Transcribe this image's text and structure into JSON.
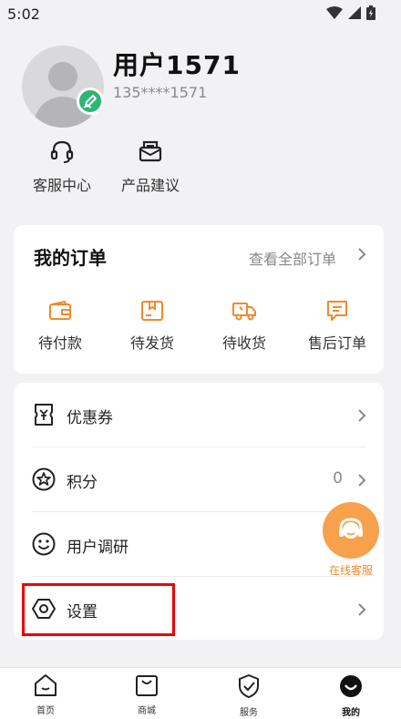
{
  "status_bar": {
    "time": "5:02"
  },
  "profile": {
    "username": "用户1571",
    "phone": "135****1571"
  },
  "quick_actions": [
    {
      "label": "客服中心",
      "icon": "headset-icon"
    },
    {
      "label": "产品建议",
      "icon": "feedback-icon"
    }
  ],
  "orders": {
    "title": "我的订单",
    "view_all": "查看全部订单",
    "items": [
      {
        "label": "待付款",
        "icon": "wallet-icon"
      },
      {
        "label": "待发货",
        "icon": "box-icon"
      },
      {
        "label": "待收货",
        "icon": "truck-icon"
      },
      {
        "label": "售后订单",
        "icon": "message-icon"
      }
    ]
  },
  "menu": [
    {
      "label": "优惠券",
      "icon": "coupon-icon",
      "value": ""
    },
    {
      "label": "积分",
      "icon": "points-icon",
      "value": "0"
    },
    {
      "label": "用户调研",
      "icon": "smile-icon",
      "value": ""
    },
    {
      "label": "设置",
      "icon": "settings-icon",
      "value": ""
    }
  ],
  "floating_service": {
    "label": "在线客服"
  },
  "tabbar": [
    {
      "label": "首页",
      "icon": "home-icon"
    },
    {
      "label": "商城",
      "icon": "shopping-bag-icon"
    },
    {
      "label": "服务",
      "icon": "shield-check-icon"
    },
    {
      "label": "我的",
      "icon": "profile-icon",
      "active": true
    }
  ],
  "colors": {
    "accent": "#f08a2b",
    "badge_green": "#2bb673",
    "highlight_red": "#e00000"
  }
}
